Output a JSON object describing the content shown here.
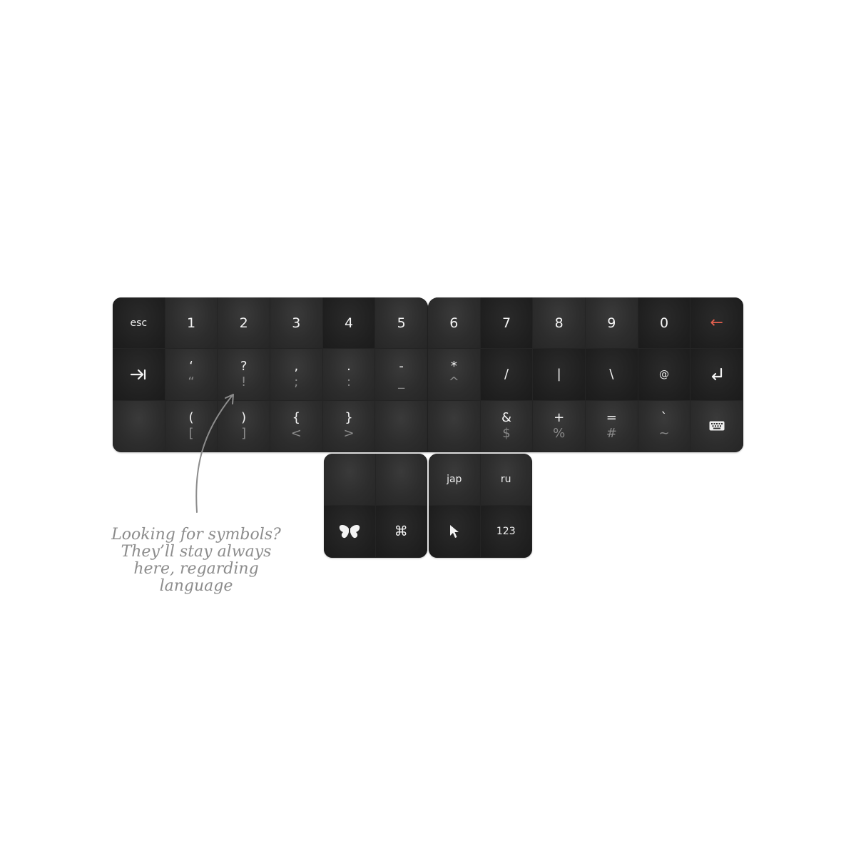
{
  "left_block": {
    "row1": [
      "esc",
      "1",
      "2",
      "3",
      "4",
      "5"
    ],
    "row2": [
      {
        "icon": "tab-arrow-icon"
      },
      {
        "top": "‘",
        "bottom": "“"
      },
      {
        "top": "?",
        "bottom": "!"
      },
      {
        "top": ",",
        "bottom": ";"
      },
      {
        "top": ".",
        "bottom": ":"
      },
      {
        "top": "-",
        "bottom": "_"
      }
    ],
    "row3": [
      {
        "top": "",
        "bottom": ""
      },
      {
        "top": "(",
        "bottom": "["
      },
      {
        "top": ")",
        "bottom": "]"
      },
      {
        "top": "{",
        "bottom": "<"
      },
      {
        "top": "}",
        "bottom": ">"
      },
      {
        "top": "",
        "bottom": ""
      }
    ]
  },
  "right_block": {
    "row1": [
      "6",
      "7",
      "8",
      "9",
      "0",
      "←"
    ],
    "row2": [
      {
        "top": "*",
        "bottom": "^"
      },
      {
        "top": "/",
        "bottom": ""
      },
      {
        "top": "|",
        "bottom": ""
      },
      {
        "top": "\\",
        "bottom": ""
      },
      {
        "top": "@",
        "bottom": ""
      },
      {
        "icon": "return-arrow-icon"
      }
    ],
    "row3": [
      {
        "top": "",
        "bottom": ""
      },
      {
        "top": "&",
        "bottom": "$"
      },
      {
        "top": "+",
        "bottom": "%"
      },
      {
        "top": "=",
        "bottom": "#"
      },
      {
        "top": "`",
        "bottom": "~"
      },
      {
        "icon": "keyboard-icon"
      }
    ]
  },
  "thumb_left": {
    "keys": [
      "",
      "",
      "butterfly-icon",
      "⌘"
    ]
  },
  "thumb_right": {
    "keys": [
      "jap",
      "ru",
      "cursor-icon",
      "123"
    ]
  },
  "annotation": {
    "lines": [
      "Looking for symbols?",
      "They’ll stay always",
      "here, regarding",
      "language"
    ]
  },
  "colors": {
    "key_bg": "#2d2d2d",
    "primary_text": "#f4f4f4",
    "secondary_text": "#8a8a8a",
    "backspace_accent": "#e2604e",
    "annotation_text": "#8c8c8c"
  }
}
